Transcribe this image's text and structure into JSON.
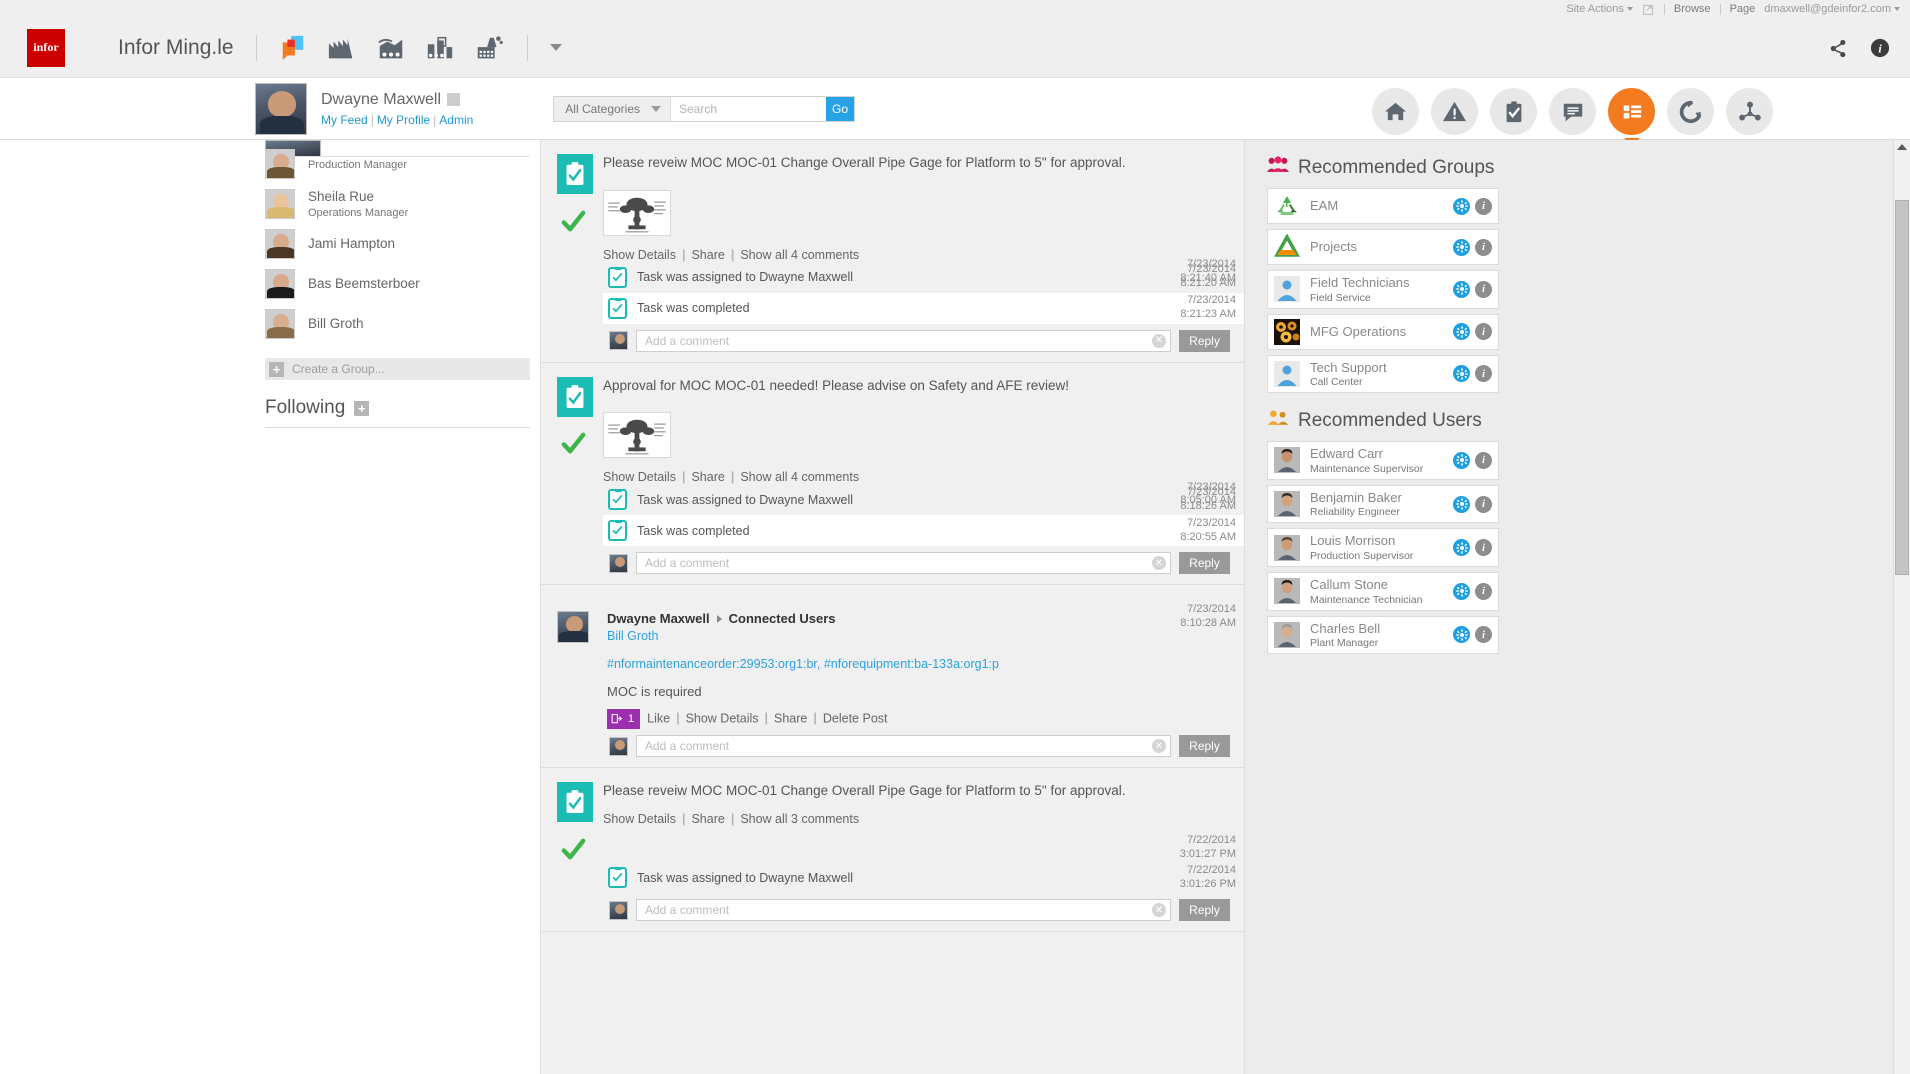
{
  "top_bar": {
    "site_actions": "Site Actions",
    "browse": "Browse",
    "page": "Page",
    "user_email": "dmaxwell@gdeinfor2.com",
    "icons": [
      "navigate-icon",
      "share-icon",
      "info-icon"
    ]
  },
  "brand": {
    "logo_text": "infor",
    "title": "Infor Ming.le",
    "app_icons": [
      "ming-le-chat-icon",
      "factory-icon",
      "analytics-chart-icon",
      "plant-icon",
      "smokestack-factory-icon"
    ],
    "dropdown_caret": "chevron-down-icon"
  },
  "user": {
    "name": "Dwayne Maxwell",
    "links": {
      "my_feed": "My Feed",
      "my_profile": "My Profile",
      "admin": "Admin"
    }
  },
  "search": {
    "category": "All Categories",
    "placeholder": "Search",
    "go_label": "Go"
  },
  "nav": [
    {
      "name": "home-icon",
      "active": false
    },
    {
      "name": "alert-warning-icon",
      "active": false
    },
    {
      "name": "clipboard-check-icon",
      "active": false
    },
    {
      "name": "message-icon",
      "active": false
    },
    {
      "name": "feed-list-icon",
      "active": true
    },
    {
      "name": "sync-refresh-icon",
      "active": false
    },
    {
      "name": "network-share-icon",
      "active": false
    }
  ],
  "sidebar": {
    "clipped_item": {
      "name": "",
      "title": "Production Manager"
    },
    "people": [
      {
        "name": "Sheila Rue",
        "title": "Operations Manager",
        "skin": "#e8c39e",
        "hair": "#d9b870"
      },
      {
        "name": "Jami Hampton",
        "title": "",
        "skin": "#d8ab8a",
        "hair": "#4a3527"
      },
      {
        "name": "Bas Beemsterboer",
        "title": "",
        "skin": "#d8a98a",
        "hair": "#1a1a1a"
      },
      {
        "name": "Bill Groth",
        "title": "",
        "skin": "#d9ae8c",
        "hair": "#8a6b4a"
      }
    ],
    "create_group": "Create a Group...",
    "following_label": "Following",
    "add_icon": "plus-icon"
  },
  "feed": {
    "posts": [
      {
        "type": "task",
        "text": "Please reveiw MOC MOC-01 Change Overall Pipe Gage for Platform to 5\" for approval.",
        "has_thumb": true,
        "timestamp_date": "7/23/2014",
        "timestamp_time": "8:21:40 AM",
        "actions": [
          "Show Details",
          "Share",
          "Show all 4 comments"
        ],
        "comments": [
          {
            "text": "Task was assigned to Dwayne Maxwell",
            "date": "7/23/2014",
            "time": "8:21:20 AM",
            "alt": false
          },
          {
            "text": "Task was completed",
            "date": "7/23/2014",
            "time": "8:21:23 AM",
            "alt": true
          }
        ],
        "comment_placeholder": "Add a comment",
        "reply_label": "Reply"
      },
      {
        "type": "task",
        "text": "Approval for MOC MOC-01 needed! Please advise on Safety and AFE review!",
        "has_thumb": true,
        "timestamp_date": "7/23/2014",
        "timestamp_time": "8:05:00 AM",
        "actions": [
          "Show Details",
          "Share",
          "Show all 4 comments"
        ],
        "comments": [
          {
            "text": "Task was assigned to Dwayne Maxwell",
            "date": "7/23/2014",
            "time": "8:18:26 AM",
            "alt": false
          },
          {
            "text": "Task was completed",
            "date": "7/23/2014",
            "time": "8:20:55 AM",
            "alt": true
          }
        ],
        "comment_placeholder": "Add a comment",
        "reply_label": "Reply"
      },
      {
        "type": "user",
        "author": "Dwayne Maxwell",
        "target": "Connected Users",
        "mention": "Bill Groth",
        "tags": "#nformaintenanceorder:29953:org1:br, #nforequipment:ba-133a:org1:p",
        "message": "MOC is required",
        "share_count": "1",
        "timestamp_date": "7/23/2014",
        "timestamp_time": "8:10:28 AM",
        "actions": [
          "Like",
          "Show Details",
          "Share",
          "Delete Post"
        ],
        "comment_placeholder": "Add a comment",
        "reply_label": "Reply"
      },
      {
        "type": "task",
        "text": "Please reveiw MOC MOC-01 Change Overall Pipe Gage for Platform to 5\" for approval.",
        "has_thumb": false,
        "timestamp_date": "7/22/2014",
        "timestamp_time": "3:01:27 PM",
        "actions": [
          "Show Details",
          "Share",
          "Show all 3 comments"
        ],
        "comments": [
          {
            "text": "Task was assigned to Dwayne Maxwell",
            "date": "7/22/2014",
            "time": "3:01:26 PM",
            "alt": false
          }
        ],
        "comment_placeholder": "Add a comment",
        "reply_label": "Reply"
      }
    ]
  },
  "right_panel": {
    "groups_heading": "Recommended Groups",
    "groups_icon": "group-people-icon",
    "groups": [
      {
        "name": "EAM",
        "sub": "",
        "thumb": "recycle-icon"
      },
      {
        "name": "Projects",
        "sub": "",
        "thumb": "triangle-logo-icon"
      },
      {
        "name": "Field Technicians",
        "sub": "Field Service",
        "thumb": "person-avatar-icon"
      },
      {
        "name": "MFG Operations",
        "sub": "",
        "thumb": "gears-photo-icon"
      },
      {
        "name": "Tech Support",
        "sub": "Call Center",
        "thumb": "person-avatar-icon"
      }
    ],
    "users_heading": "Recommended Users",
    "users_icon": "users-pair-icon",
    "users": [
      {
        "name": "Edward Carr",
        "sub": "Maintenance Supervisor",
        "skin": "#c98f6a",
        "hair": "#2a1d14"
      },
      {
        "name": "Benjamin Baker",
        "sub": "Reliability Engineer",
        "skin": "#d6a07a",
        "hair": "#3a2a1c"
      },
      {
        "name": "Louis Morrison",
        "sub": "Production Supervisor",
        "skin": "#cf9a74",
        "hair": "#5a4431"
      },
      {
        "name": "Callum Stone",
        "sub": "Maintenance Technician",
        "skin": "#d2a07c",
        "hair": "#241812"
      },
      {
        "name": "Charles Bell",
        "sub": "Plant Manager",
        "skin": "#d8ad8c",
        "hair": "#9a9a9a"
      }
    ],
    "card_icons": {
      "gear": "gear-icon",
      "info": "info-icon"
    }
  },
  "colors": {
    "accent_orange": "#f47a20",
    "teal": "#1bbcb4",
    "link_blue": "#2aa3e0",
    "purple": "#9b2fae",
    "infor_red": "#cc0000",
    "green": "#3cb54a"
  }
}
